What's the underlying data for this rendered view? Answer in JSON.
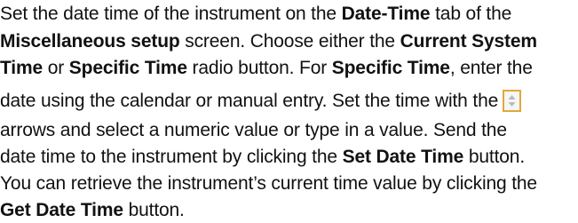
{
  "paragraph": {
    "line1": {
      "t1": "Set the date time of the instrument on the ",
      "b1": "Date-Time",
      "t2": " tab of the"
    },
    "line2": {
      "b1": "Miscellaneous setup",
      "t1": " screen. Choose either the ",
      "b2": "Current System"
    },
    "line3": {
      "b1": "Time",
      "t1": " or ",
      "b2": "Specific Time",
      "t2": " radio button. For ",
      "b3": "Specific Time",
      "t3": ", enter the"
    },
    "line4": {
      "t1": "date using the calendar or manual entry. Set the time with the"
    },
    "line5": {
      "t1": "arrows and select a numeric value or type in a value. Send the"
    },
    "line6": {
      "t1": "date time to the instrument by clicking the ",
      "b1": "Set Date Time",
      "t2": " button."
    },
    "line7": {
      "t1": "You can retrieve the instrument’s current time value by clicking the"
    },
    "line8": {
      "b1": "Get Date Time",
      "t1": " button."
    }
  },
  "icons": {
    "spinner": "up-down-arrows-icon"
  }
}
